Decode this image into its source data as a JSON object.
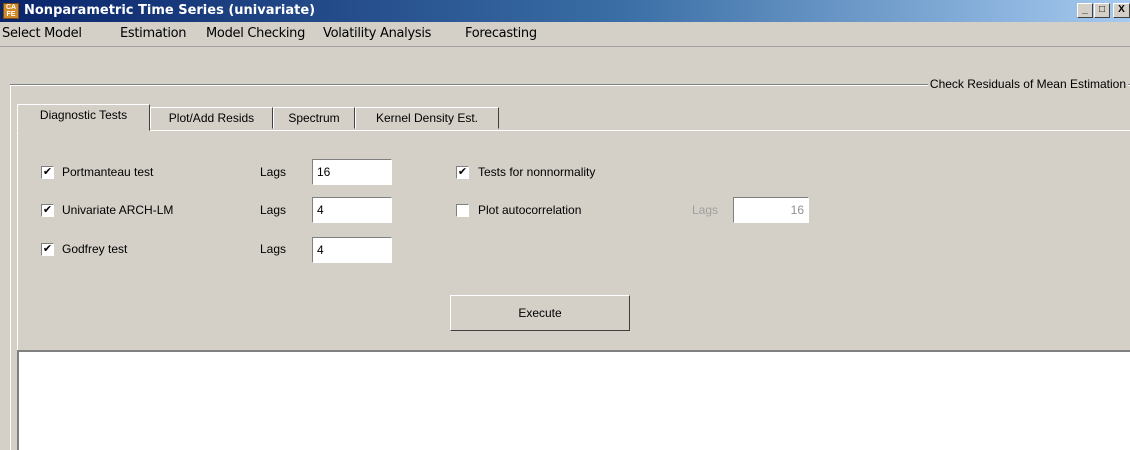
{
  "window": {
    "title": "Nonparametric Time Series (univariate)",
    "icon_top": "CA",
    "icon_bottom": "FE",
    "minimize": "_",
    "maximize": "□",
    "close": "X"
  },
  "menu": [
    "Select Model",
    "Estimation",
    "Model Checking",
    "Volatility Analysis",
    "Forecasting"
  ],
  "section_title": "Check Residuals of Mean Estimation",
  "tabs": [
    "Diagnostic Tests",
    "Plot/Add Resids",
    "Spectrum",
    "Kernel Density Est."
  ],
  "active_tab": 0,
  "left_tests": [
    {
      "label": "Portmanteau test",
      "checked": true,
      "lags_label": "Lags",
      "lags_value": "16"
    },
    {
      "label": "Univariate ARCH-LM",
      "checked": true,
      "lags_label": "Lags",
      "lags_value": "4"
    },
    {
      "label": "Godfrey test",
      "checked": true,
      "lags_label": "Lags",
      "lags_value": "4"
    }
  ],
  "right_tests": [
    {
      "label": "Tests for nonnormality",
      "checked": true
    },
    {
      "label": "Plot autocorrelation",
      "checked": false,
      "lags_label": "Lags",
      "lags_value": "16",
      "enabled": false
    }
  ],
  "execute_label": "Execute",
  "check_mark": "✔"
}
